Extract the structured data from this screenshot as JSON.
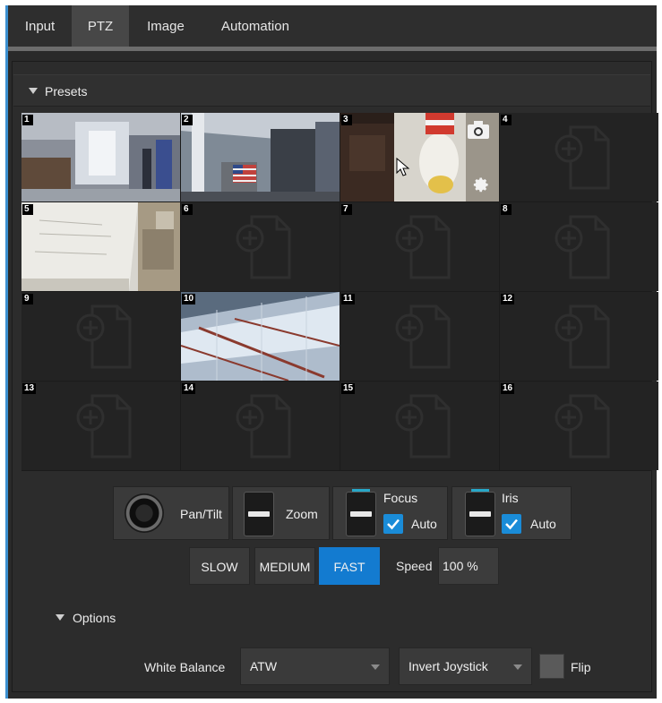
{
  "tabs": [
    {
      "label": "Input",
      "active": false
    },
    {
      "label": "PTZ",
      "active": true
    },
    {
      "label": "Image",
      "active": false
    },
    {
      "label": "Automation",
      "active": false
    }
  ],
  "presets": {
    "header": "Presets",
    "cells": [
      {
        "number": "1",
        "has_image": true
      },
      {
        "number": "2",
        "has_image": true
      },
      {
        "number": "3",
        "has_image": true,
        "hovered": true
      },
      {
        "number": "4",
        "has_image": false
      },
      {
        "number": "5",
        "has_image": true
      },
      {
        "number": "6",
        "has_image": false
      },
      {
        "number": "7",
        "has_image": false
      },
      {
        "number": "8",
        "has_image": false
      },
      {
        "number": "9",
        "has_image": false
      },
      {
        "number": "10",
        "has_image": true
      },
      {
        "number": "11",
        "has_image": false
      },
      {
        "number": "12",
        "has_image": false
      },
      {
        "number": "13",
        "has_image": false
      },
      {
        "number": "14",
        "has_image": false
      },
      {
        "number": "15",
        "has_image": false
      },
      {
        "number": "16",
        "has_image": false
      }
    ],
    "hover_icons": [
      "camera-icon",
      "gear-icon"
    ]
  },
  "controls": {
    "pan_tilt_label": "Pan/Tilt",
    "zoom_label": "Zoom",
    "focus_label": "Focus",
    "focus_auto_label": "Auto",
    "focus_auto_checked": true,
    "iris_label": "Iris",
    "iris_auto_label": "Auto",
    "iris_auto_checked": true
  },
  "speed": {
    "buttons": [
      "SLOW",
      "MEDIUM",
      "FAST"
    ],
    "selected": "FAST",
    "label": "Speed",
    "value": "100 %"
  },
  "options": {
    "header": "Options",
    "white_balance_label": "White Balance",
    "white_balance_value": "ATW",
    "invert_joystick_value": "Invert Joystick",
    "flip_label": "Flip",
    "flip_checked": false
  },
  "colors": {
    "accent": "#137bd0",
    "checkbox": "#1a8cd8",
    "background": "#2a2a2a",
    "slider_tick": "#27a7c8"
  }
}
